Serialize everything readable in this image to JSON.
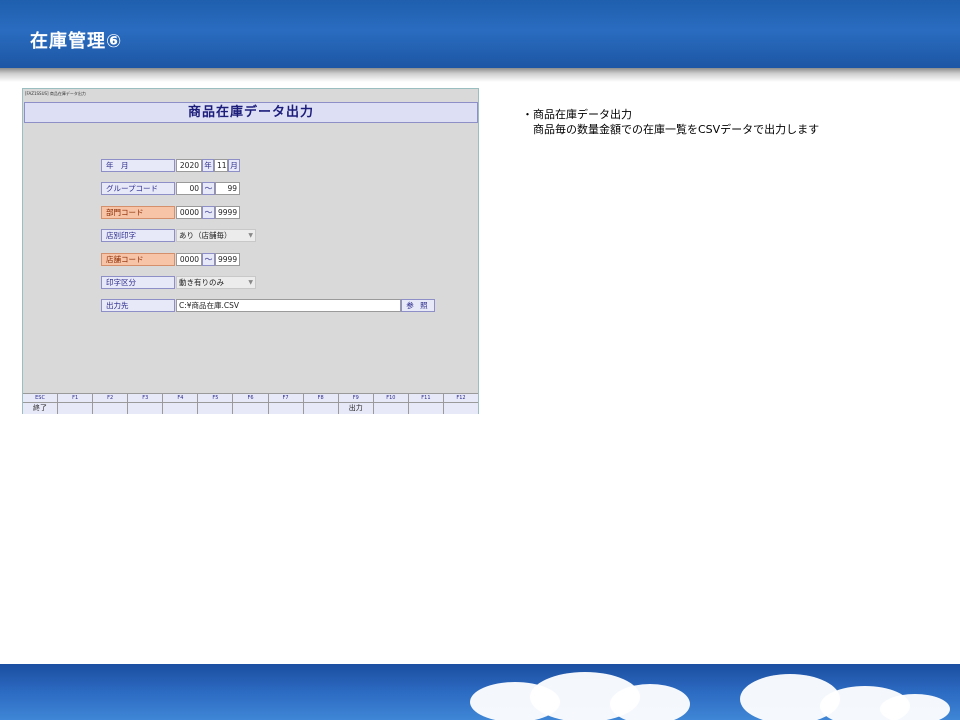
{
  "slide": {
    "title": "在庫管理⑥"
  },
  "window": {
    "caption": "[FAZ1SSUS] 商品在庫データ出力",
    "title": "商品在庫データ出力"
  },
  "form": {
    "year_month": {
      "label": "年　月",
      "year": "2020",
      "year_unit": "年",
      "month": "11",
      "month_unit": "月"
    },
    "group_code": {
      "label": "グループコード",
      "from": "00",
      "tilde": "〜",
      "to": "99"
    },
    "dept_code": {
      "label": "部門コード",
      "from": "0000",
      "tilde": "〜",
      "to": "9999"
    },
    "store_print": {
      "label": "店別印字",
      "value": "あり（店舗毎）"
    },
    "store_code": {
      "label": "店舗コード",
      "from": "0000",
      "tilde": "〜",
      "to": "9999"
    },
    "print_type": {
      "label": "印字区分",
      "value": "動き有りのみ"
    },
    "output": {
      "label": "出力先",
      "value": "C:¥商品在庫.CSV",
      "browse_label": "参 照"
    }
  },
  "fkeys": [
    {
      "name": "ESC",
      "label": "終了"
    },
    {
      "name": "F1",
      "label": ""
    },
    {
      "name": "F2",
      "label": ""
    },
    {
      "name": "F3",
      "label": ""
    },
    {
      "name": "F4",
      "label": ""
    },
    {
      "name": "F5",
      "label": ""
    },
    {
      "name": "F6",
      "label": ""
    },
    {
      "name": "F7",
      "label": ""
    },
    {
      "name": "F8",
      "label": ""
    },
    {
      "name": "F9",
      "label": "出力"
    },
    {
      "name": "F10",
      "label": ""
    },
    {
      "name": "F11",
      "label": ""
    },
    {
      "name": "F12",
      "label": ""
    }
  ],
  "note": {
    "line1": "・商品在庫データ出力",
    "line2": "商品毎の数量金額での在庫一覧をCSVデータで出力します"
  },
  "colors": {
    "header_blue": "#1f5fae",
    "label_orange": "#f7c4a8",
    "label_blue": "#e8e9f8",
    "title_text": "#1c1c7a"
  }
}
